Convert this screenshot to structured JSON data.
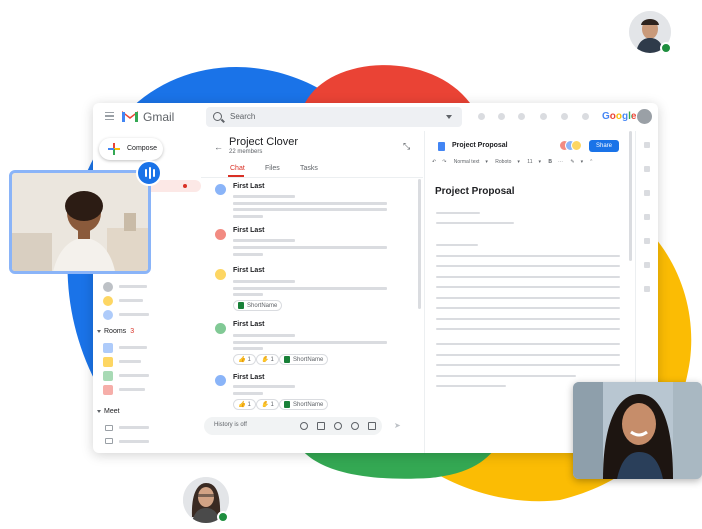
{
  "colors": {
    "blue": "#1a73e8",
    "red": "#ea4335",
    "yellow": "#fbbc04",
    "green": "#34a853",
    "online": "#1e8e3e"
  },
  "app": {
    "name": "Gmail",
    "brand": "Google"
  },
  "search": {
    "placeholder": "Search"
  },
  "compose": {
    "label": "Compose"
  },
  "sections": {
    "rooms_label": "Rooms",
    "rooms_count": "3",
    "meet_label": "Meet"
  },
  "room": {
    "title": "Project Clover",
    "members": "22 members",
    "tabs": [
      {
        "label": "Chat"
      },
      {
        "label": "Files"
      },
      {
        "label": "Tasks"
      }
    ]
  },
  "messages": [
    {
      "author": "First Last"
    },
    {
      "author": "First Last"
    },
    {
      "author": "First Last",
      "attachment": "ShortName"
    },
    {
      "author": "First Last",
      "reaction_1": "1",
      "reaction_2": "1",
      "attachment": "ShortName"
    },
    {
      "author": "First Last",
      "reaction_1": "1",
      "reaction_2": "1",
      "attachment": "ShortName"
    }
  ],
  "composer": {
    "placeholder": "History is off"
  },
  "doc": {
    "title": "Project Proposal",
    "heading": "Project Proposal",
    "share_label": "Share",
    "toolbar": {
      "style": "Normal text",
      "font": "Roboto",
      "size": "11",
      "bold": "B"
    }
  },
  "icons": {
    "menu": "hamburger-icon",
    "search": "search-icon",
    "compose": "plus-icon",
    "back": "arrow-left-icon",
    "pin": "pin-icon",
    "send": "send-icon",
    "audio": "audio-levels-icon"
  }
}
